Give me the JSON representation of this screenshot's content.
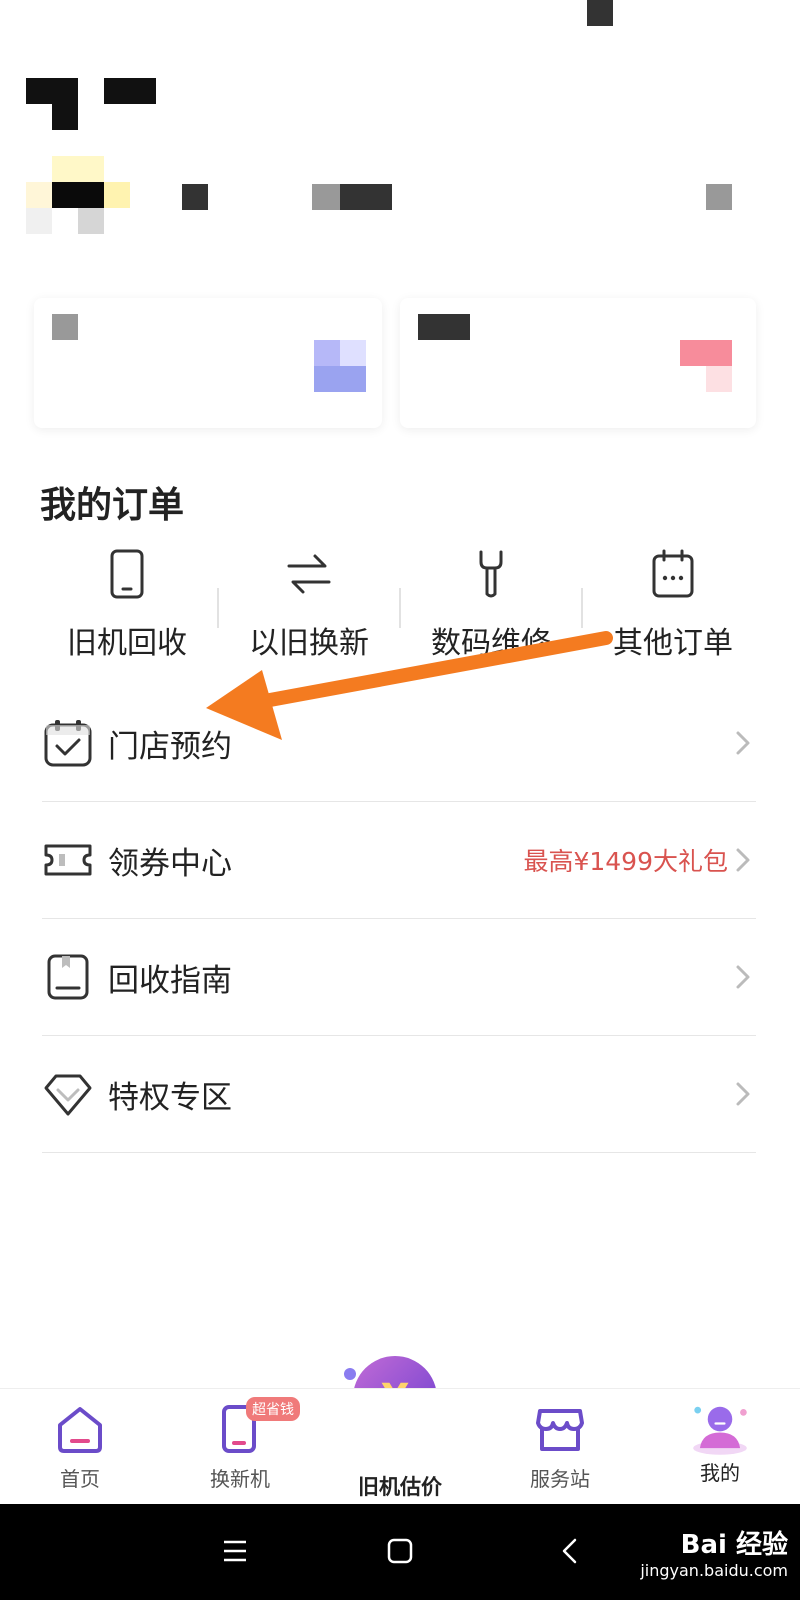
{
  "orders_section": {
    "title": "我的订单",
    "items": [
      {
        "label": "旧机回收",
        "icon": "phone-icon"
      },
      {
        "label": "以旧换新",
        "icon": "swap-icon"
      },
      {
        "label": "数码维修",
        "icon": "wrench-icon"
      },
      {
        "label": "其他订单",
        "icon": "calendar-icon"
      }
    ]
  },
  "menu": [
    {
      "label": "门店预约",
      "icon": "calendar-check-icon",
      "extra": ""
    },
    {
      "label": "领券中心",
      "icon": "ticket-icon",
      "extra": "最高¥1499大礼包"
    },
    {
      "label": "回收指南",
      "icon": "guide-book-icon",
      "extra": ""
    },
    {
      "label": "特权专区",
      "icon": "diamond-icon",
      "extra": ""
    }
  ],
  "tabbar": {
    "tabs": [
      {
        "label": "首页",
        "icon": "home-icon"
      },
      {
        "label": "换新机",
        "icon": "new-phone-icon",
        "badge": "超省钱"
      },
      {
        "label": "旧机估价",
        "icon": "yuan-coin-icon"
      },
      {
        "label": "服务站",
        "icon": "store-icon"
      },
      {
        "label": "我的",
        "icon": "profile-icon"
      }
    ]
  },
  "system_nav": {
    "buttons": [
      "menu-icon",
      "home-square-icon",
      "back-icon"
    ]
  },
  "watermark": {
    "brand": "Bai 经验",
    "url": "jingyan.baidu.com"
  },
  "colors": {
    "accent_orange": "#f47b20",
    "promo_red": "#d9534f",
    "tab_purple": "#6b4cc9"
  }
}
